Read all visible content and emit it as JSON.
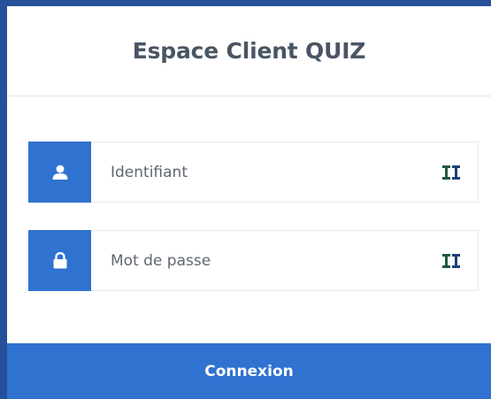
{
  "form": {
    "title": "Espace Client QUIZ",
    "username": {
      "placeholder": "Identifiant",
      "value": "",
      "icon": "user-icon"
    },
    "password": {
      "placeholder": "Mot de passe",
      "value": "",
      "icon": "lock-icon"
    },
    "field_end_icon": "bitwarden-autofill-icon",
    "submit_label": "Connexion"
  },
  "colors": {
    "background": "#28509a",
    "accent": "#2f72d0",
    "title": "#4a5563",
    "autofill_icon": "#1f5a3a"
  }
}
